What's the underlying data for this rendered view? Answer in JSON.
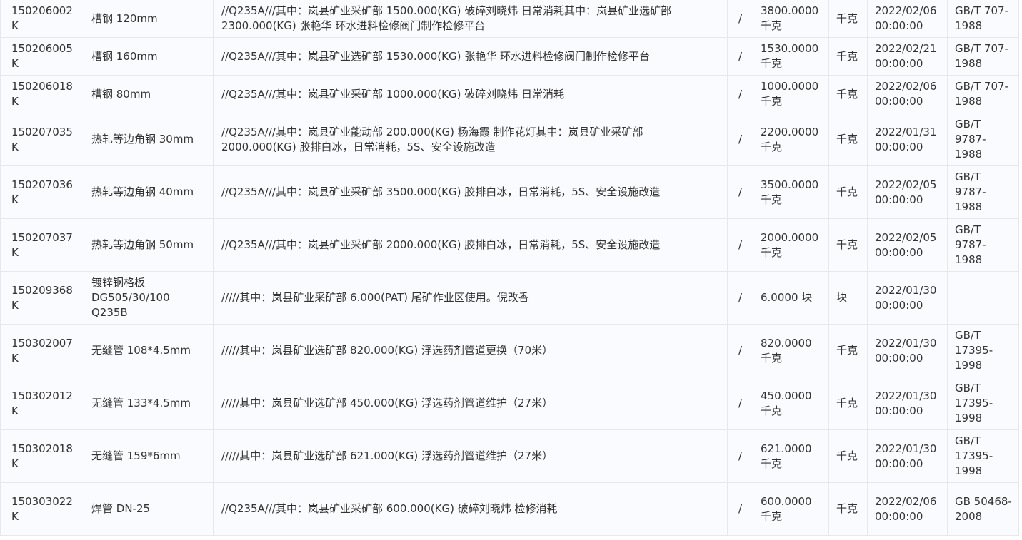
{
  "rows": [
    {
      "code": "150206002K",
      "name": "槽钢 120mm",
      "desc": "//Q235A///其中：岚县矿业采矿部 1500.000(KG) 破碎刘晓炜 日常消耗其中：岚县矿业选矿部 2300.000(KG) 张艳华 环水进料检修阀门制作检修平台",
      "sep": "/",
      "qty": "3800.0000 千克",
      "unit": "千克",
      "date": "2022/02/06 00:00:00",
      "std": "GB/T 707-1988"
    },
    {
      "code": "150206005K",
      "name": "槽钢 160mm",
      "desc": "//Q235A///其中：岚县矿业选矿部 1530.000(KG) 张艳华 环水进料检修阀门制作检修平台",
      "sep": "/",
      "qty": "1530.0000 千克",
      "unit": "千克",
      "date": "2022/02/21 00:00:00",
      "std": "GB/T 707-1988"
    },
    {
      "code": "150206018K",
      "name": "槽钢 80mm",
      "desc": "//Q235A///其中：岚县矿业采矿部 1000.000(KG) 破碎刘晓炜 日常消耗",
      "sep": "/",
      "qty": "1000.0000 千克",
      "unit": "千克",
      "date": "2022/02/06 00:00:00",
      "std": "GB/T 707-1988"
    },
    {
      "code": "150207035K",
      "name": "热轧等边角钢 30mm",
      "desc": "//Q235A///其中：岚县矿业能动部 200.000(KG) 杨海霞 制作花灯其中：岚县矿业采矿部 2000.000(KG) 胶排白冰，日常消耗，5S、安全设施改造",
      "sep": "/",
      "qty": "2200.0000 千克",
      "unit": "千克",
      "date": "2022/01/31 00:00:00",
      "std": "GB/T 9787-1988"
    },
    {
      "code": "150207036K",
      "name": "热轧等边角钢 40mm",
      "desc": "//Q235A///其中：岚县矿业采矿部 3500.000(KG) 胶排白冰，日常消耗，5S、安全设施改造",
      "sep": "/",
      "qty": "3500.0000 千克",
      "unit": "千克",
      "date": "2022/02/05 00:00:00",
      "std": "GB/T 9787-1988"
    },
    {
      "code": "150207037K",
      "name": "热轧等边角钢 50mm",
      "desc": "//Q235A///其中：岚县矿业采矿部 2000.000(KG) 胶排白冰，日常消耗，5S、安全设施改造",
      "sep": "/",
      "qty": "2000.0000 千克",
      "unit": "千克",
      "date": "2022/02/05 00:00:00",
      "std": "GB/T 9787-1988"
    },
    {
      "code": "150209368K",
      "name": "镀锌钢格板 DG505/30/100 Q235B",
      "desc": "/////其中：岚县矿业采矿部 6.000(PAT) 尾矿作业区使用。倪改香",
      "sep": "/",
      "qty": "6.0000 块",
      "unit": "块",
      "date": "2022/01/30 00:00:00",
      "std": ""
    },
    {
      "code": "150302007K",
      "name": "无缝管 108*4.5mm",
      "desc": "/////其中：岚县矿业选矿部 820.000(KG) 浮选药剂管道更换（70米）",
      "sep": "/",
      "qty": "820.0000 千克",
      "unit": "千克",
      "date": "2022/01/30 00:00:00",
      "std": "GB/T 17395-1998"
    },
    {
      "code": "150302012K",
      "name": "无缝管 133*4.5mm",
      "desc": "/////其中：岚县矿业选矿部 450.000(KG) 浮选药剂管道维护（27米）",
      "sep": "/",
      "qty": "450.0000 千克",
      "unit": "千克",
      "date": "2022/01/30 00:00:00",
      "std": "GB/T 17395-1998"
    },
    {
      "code": "150302018K",
      "name": "无缝管 159*6mm",
      "desc": "/////其中：岚县矿业选矿部 621.000(KG) 浮选药剂管道维护（27米）",
      "sep": "/",
      "qty": "621.0000 千克",
      "unit": "千克",
      "date": "2022/01/30 00:00:00",
      "std": "GB/T 17395-1998"
    },
    {
      "code": "150303022K",
      "name": "焊管 DN-25",
      "desc": "//Q235A///其中：岚县矿业采矿部 600.000(KG) 破碎刘晓炜 检修消耗",
      "sep": "/",
      "qty": "600.0000 千克",
      "unit": "千克",
      "date": "2022/02/06 00:00:00",
      "std": "GB 50468-2008"
    }
  ]
}
